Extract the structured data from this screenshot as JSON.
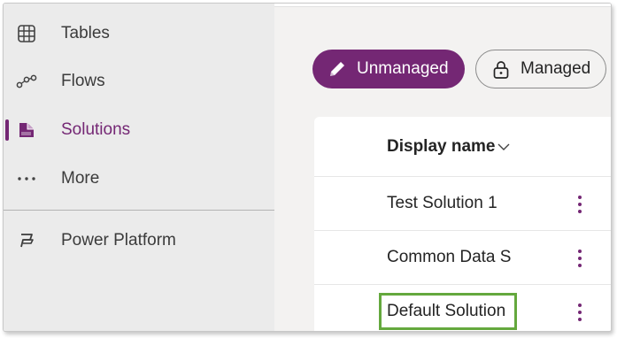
{
  "sidebar": {
    "items": [
      {
        "label": "Tables",
        "icon": "table-icon"
      },
      {
        "label": "Flows",
        "icon": "flow-icon"
      },
      {
        "label": "Solutions",
        "icon": "solutions-icon",
        "active": true
      },
      {
        "label": "More",
        "icon": "more-icon"
      }
    ],
    "footer_item": {
      "label": "Power Platform",
      "icon": "power-platform-icon"
    },
    "active_color": "#742774"
  },
  "filters": {
    "unmanaged_label": "Unmanaged",
    "managed_label": "Managed",
    "selected": "Unmanaged"
  },
  "table": {
    "column_header": "Display name",
    "sort_icon": "chevron-down-icon",
    "rows": [
      {
        "name": "Test Solution 1"
      },
      {
        "name": "Common Data S"
      },
      {
        "name": "Default Solution",
        "highlighted": true
      }
    ],
    "highlight_color": "#64a83d"
  }
}
